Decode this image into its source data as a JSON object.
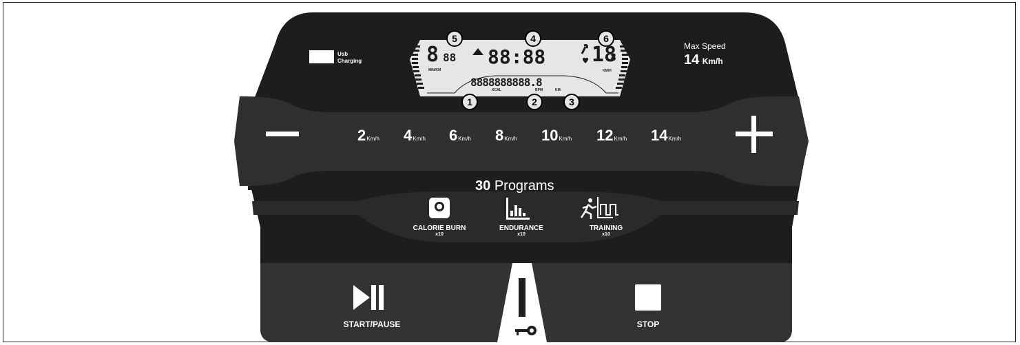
{
  "usb": {
    "label_line1": "Usb",
    "label_line2": "Charging"
  },
  "max_speed": {
    "title": "Max Speed",
    "value": "14",
    "unit": "Km/h"
  },
  "lcd": {
    "markers": [
      "5",
      "4",
      "6",
      "1",
      "2",
      "3"
    ],
    "left_digits": "8",
    "left_small": "88",
    "left_unit": "MIN/KM",
    "center_digits": "88:88",
    "right_digits": "18",
    "right_small": ".8",
    "right_unit": "KM/H",
    "bottom_digits": "8888888888.8",
    "bottom_labels": [
      "KCAL",
      "BPM",
      "KM"
    ]
  },
  "speed_bar": {
    "minus": "—",
    "plus": "+",
    "presets": [
      {
        "value": "2",
        "unit": "Km/h"
      },
      {
        "value": "4",
        "unit": "Km/h"
      },
      {
        "value": "6",
        "unit": "Km/h"
      },
      {
        "value": "8",
        "unit": "Km/h"
      },
      {
        "value": "10",
        "unit": "Km/h"
      },
      {
        "value": "12",
        "unit": "Km/h"
      },
      {
        "value": "14",
        "unit": "Km/h"
      }
    ]
  },
  "programs": {
    "count": "30",
    "title": "Programs",
    "items": [
      {
        "label": "CALORIE BURN",
        "sub": "x10",
        "icon": "weight-scale-icon"
      },
      {
        "label": "ENDURANCE",
        "sub": "x10",
        "icon": "bar-chart-icon"
      },
      {
        "label": "TRAINING",
        "sub": "x10",
        "icon": "runner-interval-icon"
      }
    ]
  },
  "controls": {
    "start_pause": "START/PAUSE",
    "stop": "STOP"
  },
  "colors": {
    "panel": "#1d1d1d",
    "band": "#2f2f2f",
    "bottom": "#333333",
    "lcd": "#e6e6e6",
    "text": "#ffffff"
  }
}
